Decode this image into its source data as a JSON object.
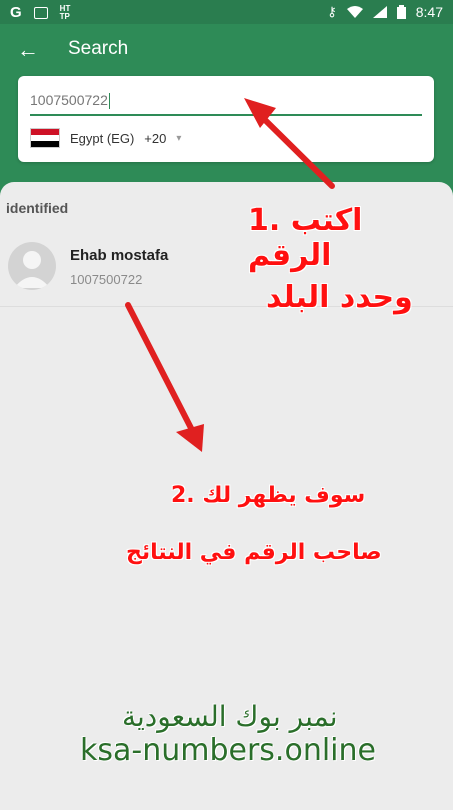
{
  "status_bar": {
    "time": "8:47",
    "left_icons": [
      "google-icon",
      "image-icon",
      "http-icon"
    ],
    "right_icons": [
      "key-icon",
      "wifi-icon",
      "signal-icon",
      "battery-icon"
    ]
  },
  "app_bar": {
    "title": "Search"
  },
  "search": {
    "value": "1007500722",
    "country_name": "Egypt (EG)",
    "dial_code": "+20"
  },
  "results": {
    "section_label": "identified",
    "items": [
      {
        "name": "Ehab mostafa",
        "phone": "1007500722"
      }
    ]
  },
  "annotations": {
    "step1_line1": "1. اكتب الرقم",
    "step1_line2": "وحدد البلد",
    "step2_line1": "2. سوف يظهر لك",
    "step2_line2": "صاحب الرقم في النتائج"
  },
  "watermark": {
    "line1": "نمبر بوك السعودية",
    "line2": "ksa-numbers.online"
  },
  "colors": {
    "primary": "#2e8b57",
    "annotation": "#ff1010"
  }
}
